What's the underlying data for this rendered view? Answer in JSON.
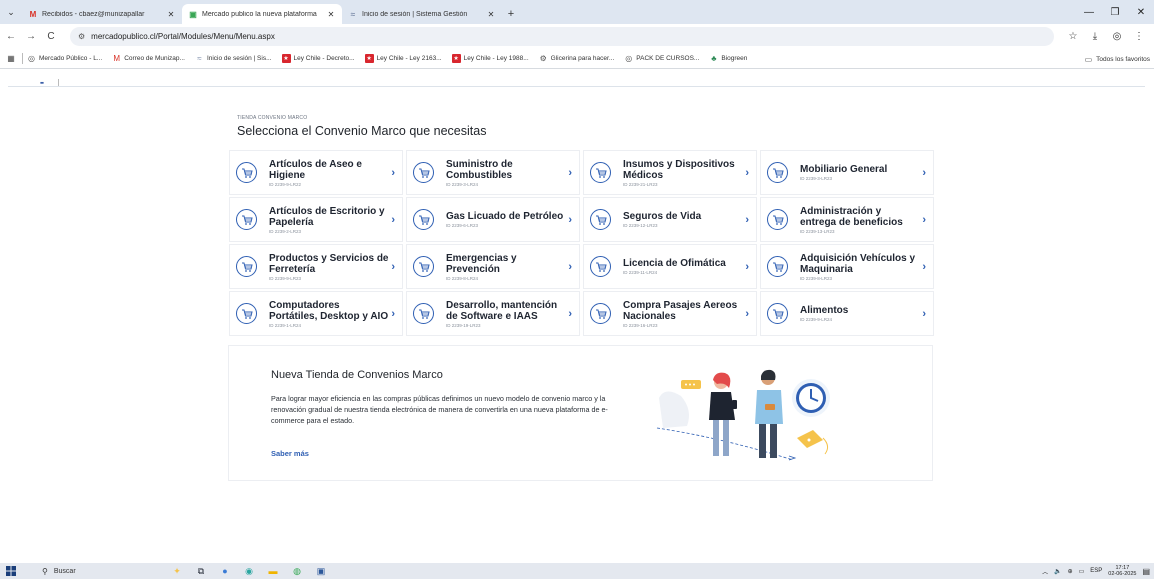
{
  "browser": {
    "tabs": [
      {
        "title": "Recibidos - cbaez@munizapallar",
        "icon": "gmail-icon",
        "active": false
      },
      {
        "title": "Mercado publico la nueva plataforma",
        "icon": "mercadopublico-icon",
        "active": true
      },
      {
        "title": "Inicio de sesión | Sistema Gestión",
        "icon": "sistema-icon",
        "active": false
      }
    ],
    "url": "mercadopublico.cl/Portal/Modules/Menu/Menu.aspx",
    "bookmarks": [
      {
        "label": "Mercado Público - L...",
        "icon": "globe-icon",
        "color": "#555555"
      },
      {
        "label": "Correo de Munizap...",
        "icon": "gmail-icon",
        "color": "#d93025"
      },
      {
        "label": "Inicio de sesión | Sis...",
        "icon": "sistema-icon",
        "color": "#7a8aa8"
      },
      {
        "label": "Ley Chile - Decreto...",
        "icon": "leychile-icon",
        "color": "#d8262e"
      },
      {
        "label": "Ley Chile - Ley 2163...",
        "icon": "leychile-icon",
        "color": "#d8262e"
      },
      {
        "label": "Ley Chile - Ley 1988...",
        "icon": "leychile-icon",
        "color": "#d8262e"
      },
      {
        "label": "Glicerina para hacer...",
        "icon": "gear-icon",
        "color": "#555555"
      },
      {
        "label": "PACK DE CURSOS...",
        "icon": "globe-icon",
        "color": "#555555"
      },
      {
        "label": "Biogreen",
        "icon": "leaf-icon",
        "color": "#2e8b57"
      }
    ],
    "all_bookmarks_label": "Todos los favoritos"
  },
  "page": {
    "eyebrow": "TIENDA CONVENIO MARCO",
    "heading": "Selecciona el Convenio Marco que necesitas",
    "cards": [
      {
        "title": "Artículos de Aseo e Higiene",
        "id": "ID 2239-9-LR22"
      },
      {
        "title": "Suministro de Combustibles",
        "id": "ID 2239-3-LR24"
      },
      {
        "title": "Insumos y Dispositivos Médicos",
        "id": "ID 2239-21-LR23"
      },
      {
        "title": "Mobiliario General",
        "id": "ID 2239-3-LR23"
      },
      {
        "title": "Artículos de Escritorio y Papelería",
        "id": "ID 2239-2-LR23"
      },
      {
        "title": "Gas Licuado de Petróleo",
        "id": "ID 2239-6-LR23"
      },
      {
        "title": "Seguros de Vida",
        "id": "ID 2239-12-LR23"
      },
      {
        "title": "Administración y entrega de beneficios",
        "id": "ID 2239-13-LR23"
      },
      {
        "title": "Productos y Servicios de Ferretería",
        "id": "ID 2239-9-LR23"
      },
      {
        "title": "Emergencias y Prevención",
        "id": "ID 2239-8-LR24"
      },
      {
        "title": "Licencia de Ofimática",
        "id": "ID 2239-11-LR24"
      },
      {
        "title": "Adquisición Vehículos y Maquinaria",
        "id": "ID 2239-8-LR23"
      },
      {
        "title": "Computadores Portátiles, Desktop y AIO",
        "id": "ID 2239-1-LR24"
      },
      {
        "title": "Desarrollo, mantención de Software e IAAS",
        "id": "ID 2239-19-LR23"
      },
      {
        "title": "Compra Pasajes Aereos Nacionales",
        "id": "ID 2239-16-LR23"
      },
      {
        "title": "Alimentos",
        "id": "ID 2239-9-LR24"
      }
    ],
    "promo": {
      "title": "Nueva Tienda de Convenios Marco",
      "text": "Para lograr mayor eficiencia en las compras públicas definimos un nuevo modelo de convenio marco y la renovación gradual de nuestra tienda electrónica de manera de convertirla en una nueva plataforma de e-commerce para el estado.",
      "link": "Saber más"
    }
  },
  "taskbar": {
    "search_label": "Buscar",
    "language": "ESP",
    "time": "17:17",
    "date": "02-06-2025"
  },
  "colors": {
    "accent": "#2f5fb3",
    "tabbar": "#dee6f1"
  }
}
